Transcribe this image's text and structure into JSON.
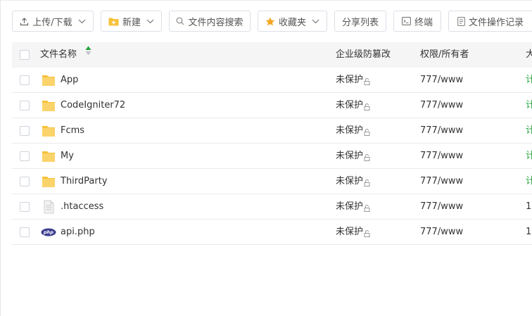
{
  "toolbar": {
    "upload_label": "上传/下载",
    "new_label": "新建",
    "search_label": "文件内容搜索",
    "favorites_label": "收藏夹",
    "share_label": "分享列表",
    "terminal_label": "终端",
    "log_label": "文件操作记录"
  },
  "table": {
    "headers": {
      "name": "文件名称",
      "protection": "企业级防篡改",
      "permission": "权限/所有者",
      "size": "大"
    },
    "rows": [
      {
        "name": "App",
        "type": "folder",
        "protection": "未保护",
        "permission": "777/www",
        "size": "计"
      },
      {
        "name": "CodeIgniter72",
        "type": "folder",
        "protection": "未保护",
        "permission": "777/www",
        "size": "计"
      },
      {
        "name": "Fcms",
        "type": "folder",
        "protection": "未保护",
        "permission": "777/www",
        "size": "计"
      },
      {
        "name": "My",
        "type": "folder",
        "protection": "未保护",
        "permission": "777/www",
        "size": "计"
      },
      {
        "name": "ThirdParty",
        "type": "folder",
        "protection": "未保护",
        "permission": "777/www",
        "size": "计"
      },
      {
        "name": ".htaccess",
        "type": "file",
        "protection": "未保护",
        "permission": "777/www",
        "size": "1"
      },
      {
        "name": "api.php",
        "type": "php",
        "protection": "未保护",
        "permission": "777/www",
        "size": "1("
      }
    ]
  },
  "colors": {
    "folder": "#f7c23b",
    "accent_green": "#20a53a",
    "header_bg": "#f5f5f5",
    "border": "#dcdfe6"
  }
}
